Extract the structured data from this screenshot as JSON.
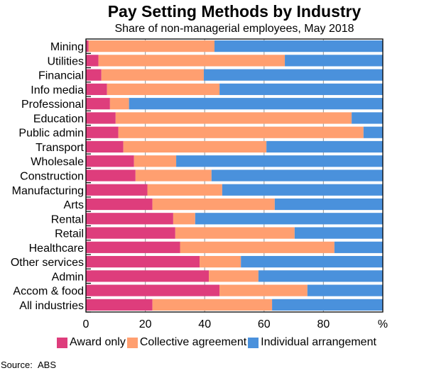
{
  "chart_data": {
    "type": "bar",
    "orientation": "horizontal",
    "stacked": true,
    "title": "Pay Setting Methods by Industry",
    "subtitle": "Share of non-managerial employees, May 2018",
    "xlabel": "",
    "ylabel": "",
    "x_unit_label": "%",
    "xlim": [
      0,
      100
    ],
    "xticks": [
      0,
      20,
      40,
      60,
      80
    ],
    "grid": true,
    "legend_position": "bottom",
    "categories": [
      "Mining",
      "Utilities",
      "Financial",
      "Info media",
      "Professional",
      "Education",
      "Public admin",
      "Transport",
      "Wholesale",
      "Construction",
      "Manufacturing",
      "Arts",
      "Rental",
      "Retail",
      "Healthcare",
      "Other services",
      "Admin",
      "Accom & food",
      "All industries"
    ],
    "series": [
      {
        "name": "Award only",
        "color": "#DE3D7C",
        "values": [
          0.9,
          4.2,
          5.2,
          7.1,
          8.1,
          10.0,
          10.9,
          12.6,
          16.2,
          16.7,
          20.7,
          22.4,
          29.4,
          30.1,
          31.7,
          38.3,
          41.4,
          45.0,
          22.4
        ]
      },
      {
        "name": "Collective agreement",
        "color": "#FF9F70",
        "values": [
          42.4,
          62.8,
          34.5,
          37.9,
          6.4,
          79.5,
          82.6,
          48.2,
          14.2,
          25.6,
          25.2,
          41.2,
          7.4,
          40.2,
          52.0,
          13.9,
          16.7,
          29.6,
          40.3
        ]
      },
      {
        "name": "Individual arrangement",
        "color": "#4A91DC",
        "values": [
          56.7,
          33.0,
          60.3,
          55.0,
          85.5,
          10.5,
          6.5,
          39.2,
          69.6,
          57.7,
          54.1,
          36.4,
          63.2,
          29.7,
          16.3,
          47.8,
          41.9,
          25.4,
          37.3
        ]
      }
    ],
    "source": "ABS"
  },
  "source": {
    "label": "Source:",
    "value": "ABS"
  }
}
